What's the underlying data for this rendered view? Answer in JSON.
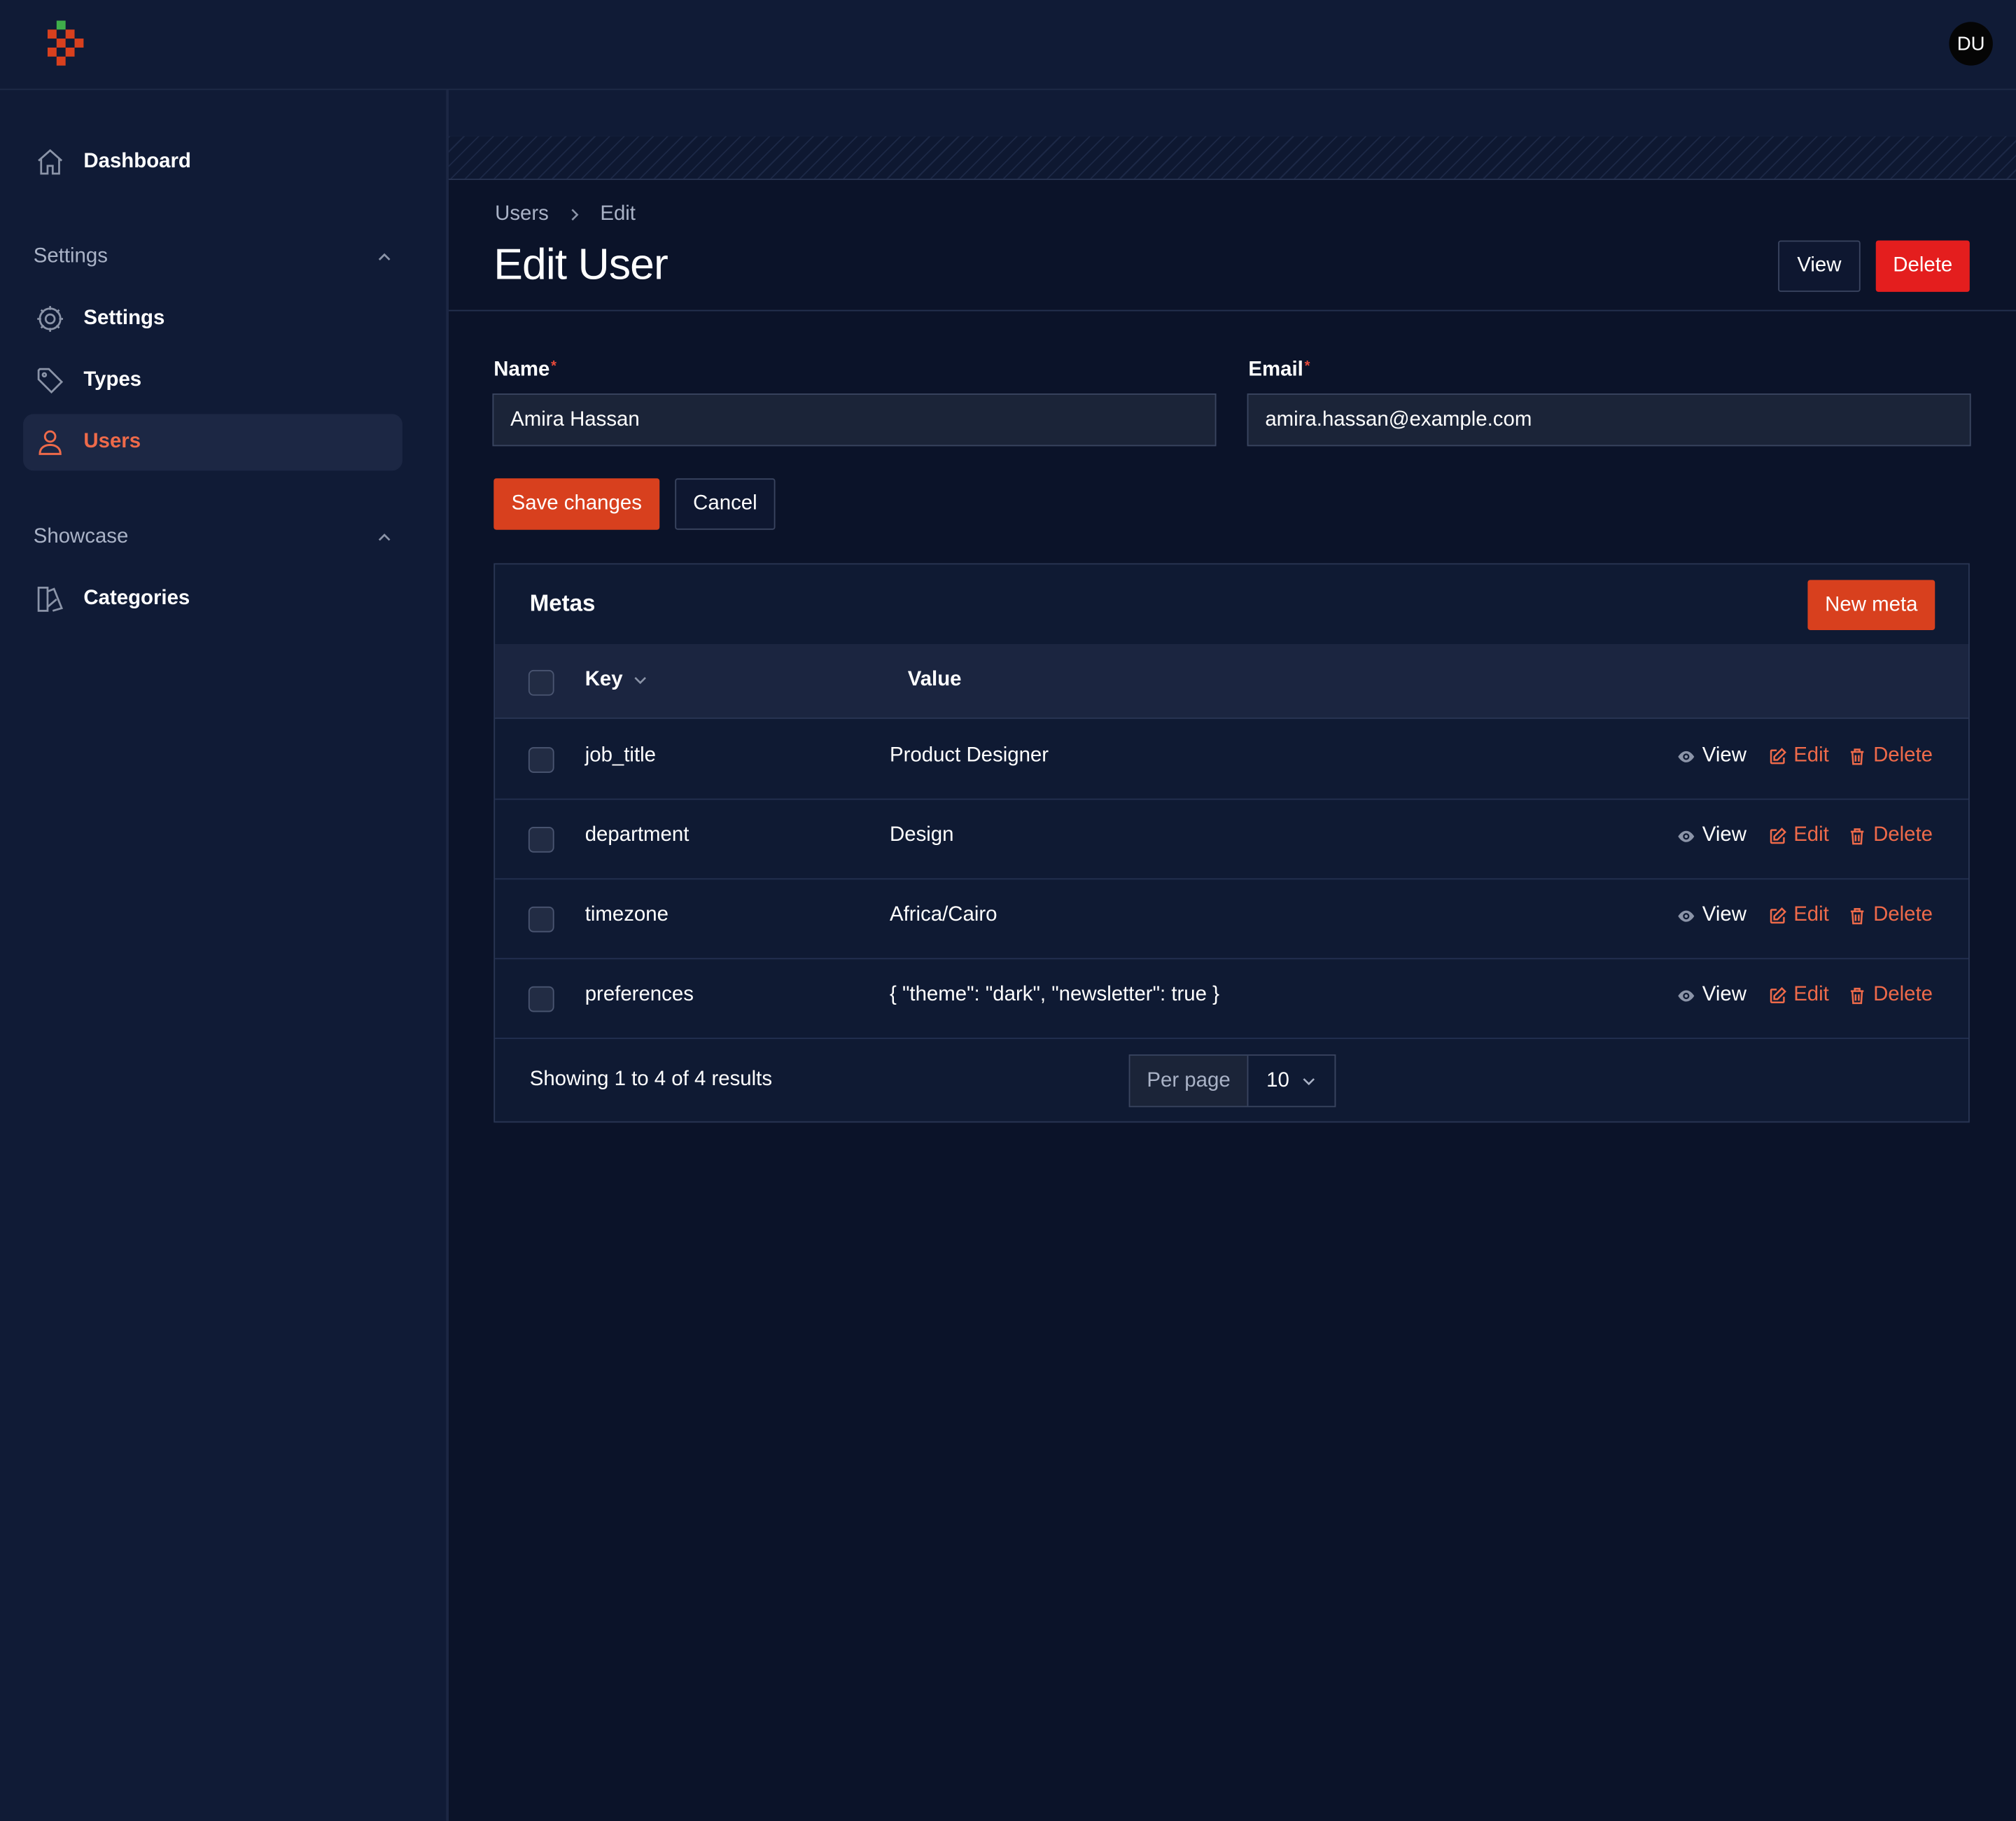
{
  "topbar": {
    "avatar_initials": "DU"
  },
  "sidebar": {
    "dashboard": "Dashboard",
    "groups": [
      {
        "title": "Settings",
        "items": [
          {
            "label": "Settings",
            "icon": "gear-icon"
          },
          {
            "label": "Types",
            "icon": "tag-icon"
          },
          {
            "label": "Users",
            "icon": "user-icon",
            "active": true
          }
        ]
      },
      {
        "title": "Showcase",
        "items": [
          {
            "label": "Categories",
            "icon": "categories-icon"
          }
        ]
      }
    ]
  },
  "breadcrumb": {
    "items": [
      "Users",
      "Edit"
    ]
  },
  "page": {
    "title": "Edit User",
    "view_label": "View",
    "delete_label": "Delete"
  },
  "form": {
    "name": {
      "label": "Name",
      "required_mark": "*",
      "value": "Amira Hassan"
    },
    "email": {
      "label": "Email",
      "required_mark": "*",
      "value": "amira.hassan@example.com"
    },
    "save_label": "Save changes",
    "cancel_label": "Cancel"
  },
  "metas": {
    "title": "Metas",
    "new_label": "New meta",
    "columns": {
      "key": "Key",
      "value": "Value"
    },
    "actions": {
      "view": "View",
      "edit": "Edit",
      "delete": "Delete"
    },
    "rows": [
      {
        "key": "job_title",
        "value": "Product Designer"
      },
      {
        "key": "department",
        "value": "Design"
      },
      {
        "key": "timezone",
        "value": "Africa/Cairo"
      },
      {
        "key": "preferences",
        "value": "{ \"theme\": \"dark\", \"newsletter\": true }"
      }
    ],
    "footer": {
      "summary": "Showing 1 to 4 of 4 results",
      "per_page_label": "Per page",
      "per_page_value": "10"
    }
  },
  "colors": {
    "accent": "#ee6a4a",
    "danger": "#e41e1e",
    "primary_button": "#d8401e",
    "background": "#0b1329",
    "panel": "#101b36"
  }
}
